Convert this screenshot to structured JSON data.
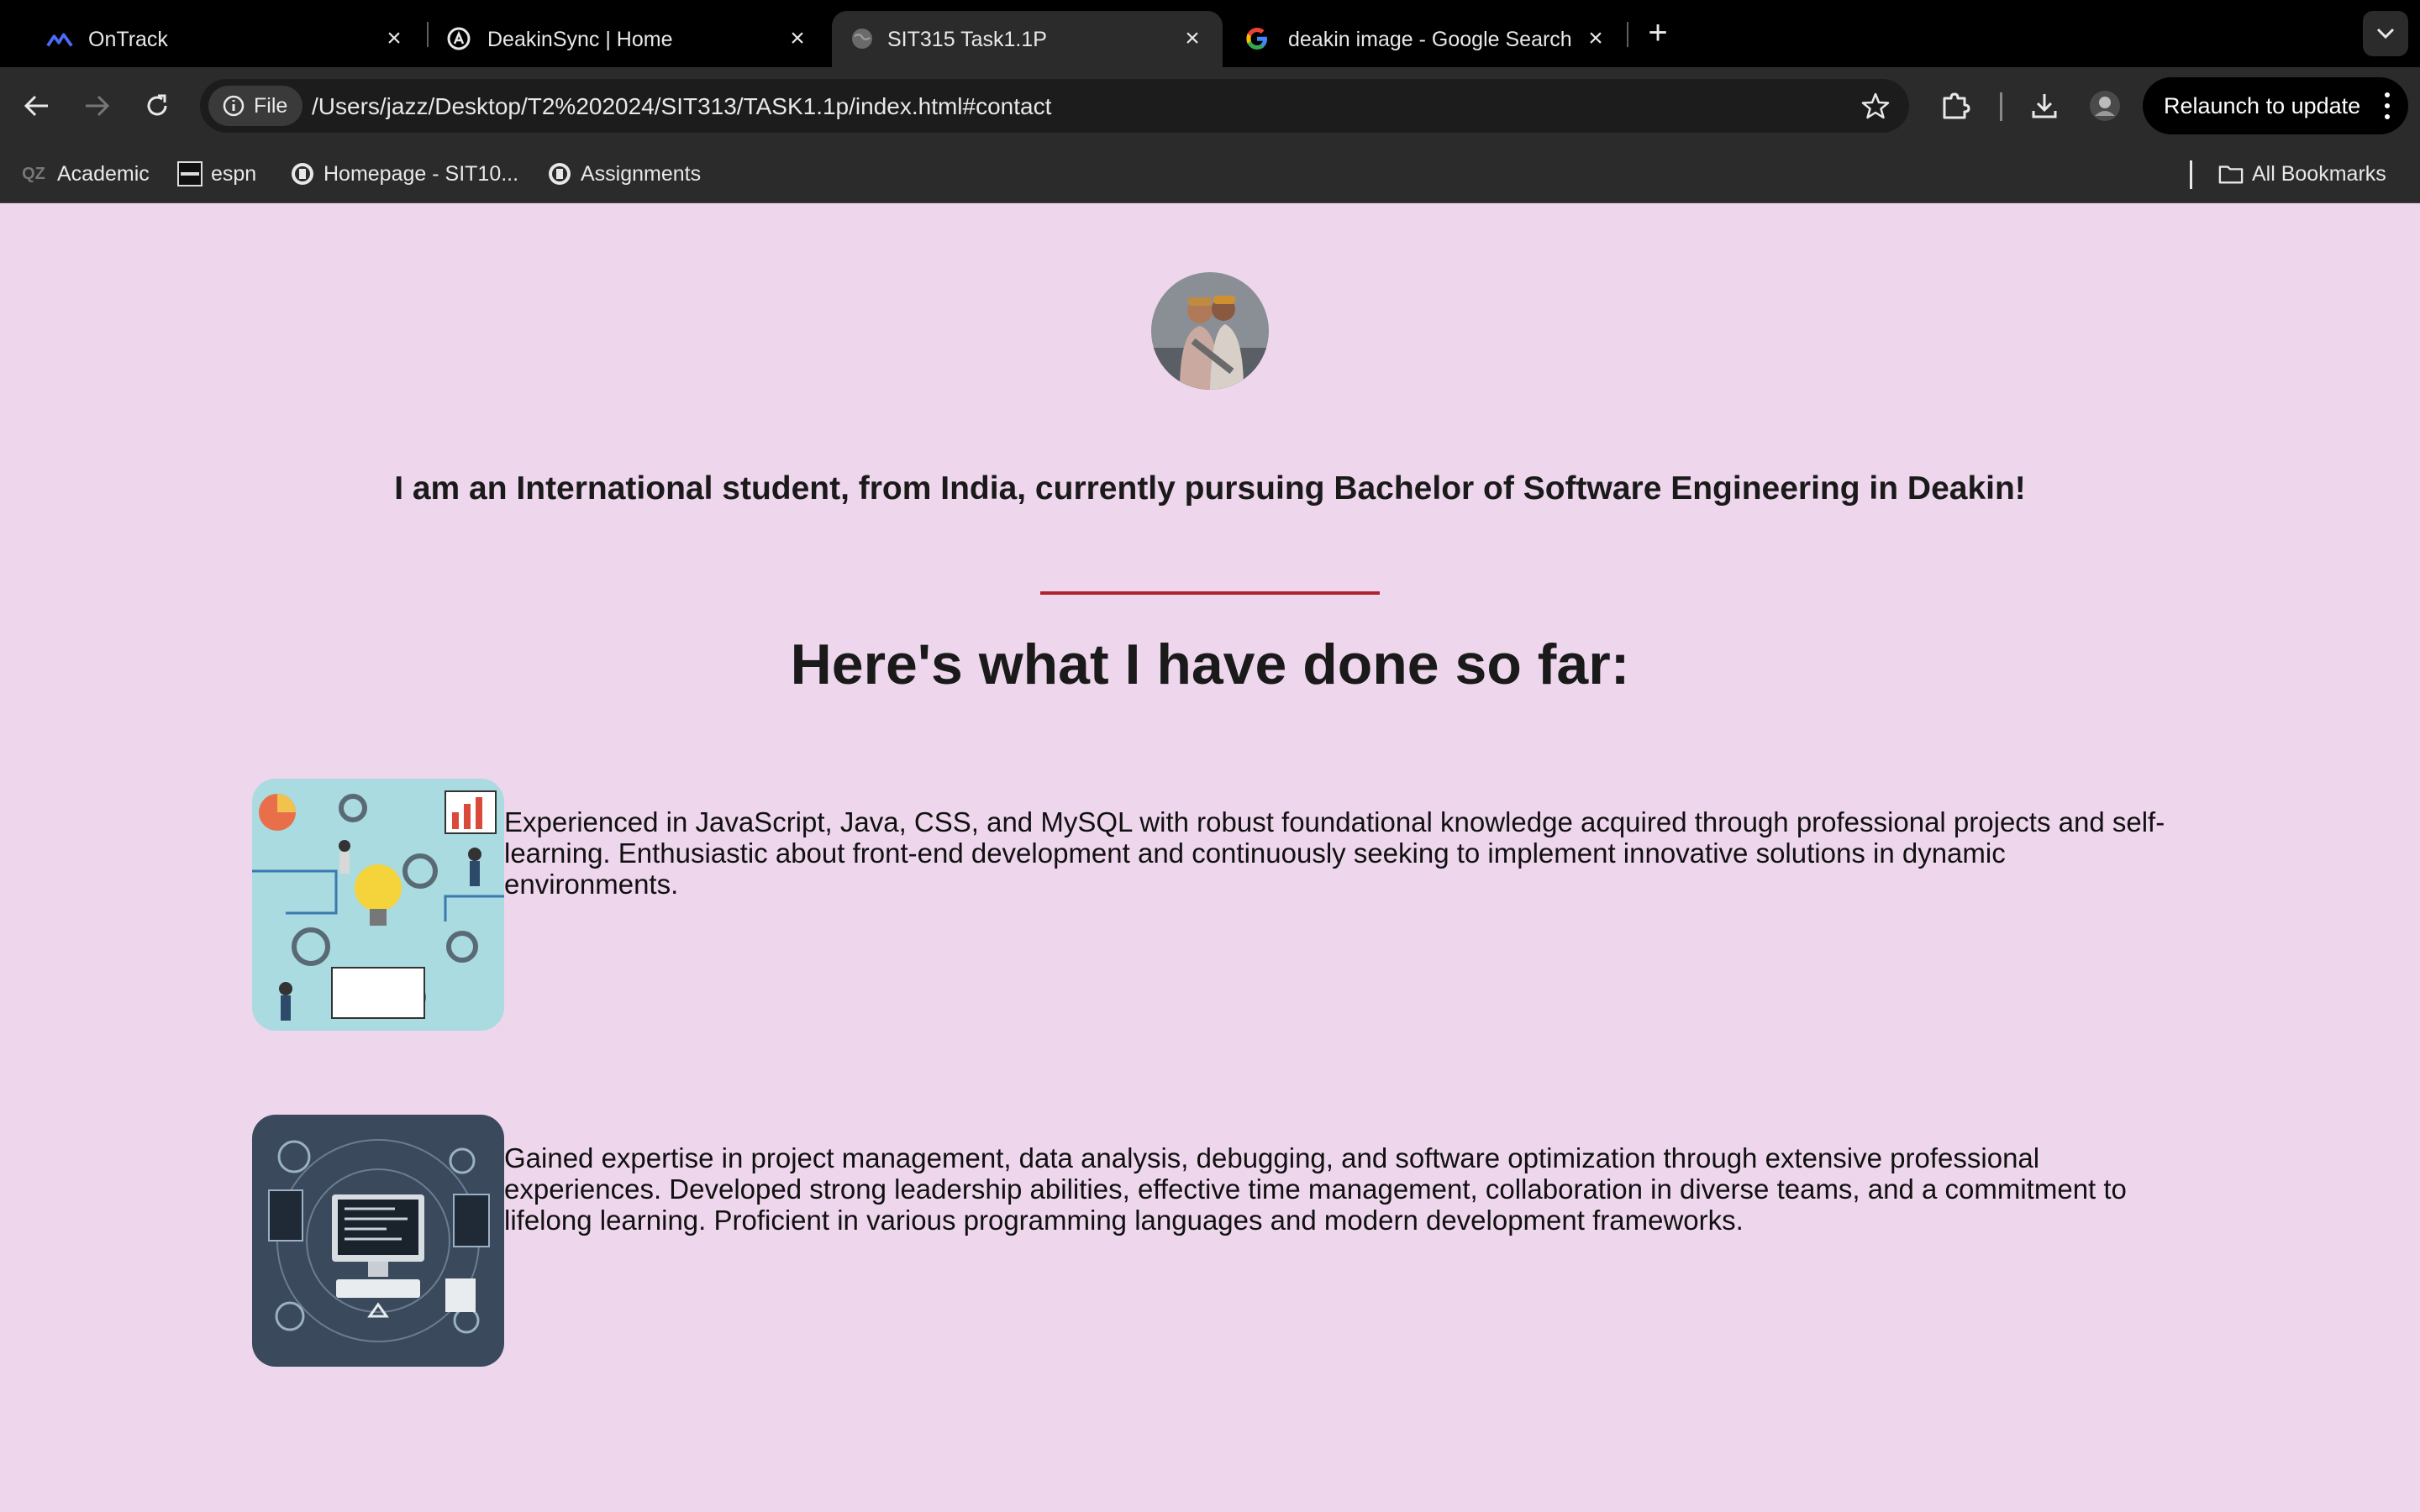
{
  "browser": {
    "tabs": [
      {
        "title": "OnTrack",
        "icon": "ontrack-logo-icon",
        "active": false
      },
      {
        "title": "DeakinSync | Home",
        "icon": "deakinsync-icon",
        "active": false
      },
      {
        "title": "SIT315 Task1.1P",
        "icon": "globe-icon",
        "active": true
      },
      {
        "title": "deakin image - Google Search",
        "icon": "google-icon",
        "active": false
      }
    ],
    "file_chip_label": "File",
    "url": "/Users/jazz/Desktop/T2%202024/SIT313/TASK1.1p/index.html#contact",
    "relaunch_label": "Relaunch to update",
    "bookmarks": [
      {
        "label": "Academic",
        "icon": "qz-icon"
      },
      {
        "label": "espn",
        "icon": "espn-icon"
      },
      {
        "label": "Homepage - SIT10...",
        "icon": "deakin-icon"
      },
      {
        "label": "Assignments",
        "icon": "deakin-icon"
      }
    ],
    "all_bookmarks_label": "All Bookmarks"
  },
  "page": {
    "intro": "I am an International student, from India, currently pursuing Bachelor of Software Engineering in Deakin!",
    "heading": "Here's what I have done so far:",
    "items": [
      {
        "image": "collaboration-illustration",
        "text": "Experienced in JavaScript, Java, CSS, and MySQL with robust foundational knowledge acquired through professional projects and self-learning. Enthusiastic about front-end development and continuously seeking to implement innovative solutions in dynamic environments."
      },
      {
        "image": "computer-tech-illustration",
        "text": "Gained expertise in project management, data analysis, debugging, and software optimization through extensive professional experiences. Developed strong leadership abilities, effective time management, collaboration in diverse teams, and a commitment to lifelong learning. Proficient in various programming languages and modern development frameworks."
      }
    ]
  },
  "colors": {
    "page_background": "#eed6ec",
    "divider": "#b0222c",
    "chrome_dark": "#2b2b2b"
  }
}
